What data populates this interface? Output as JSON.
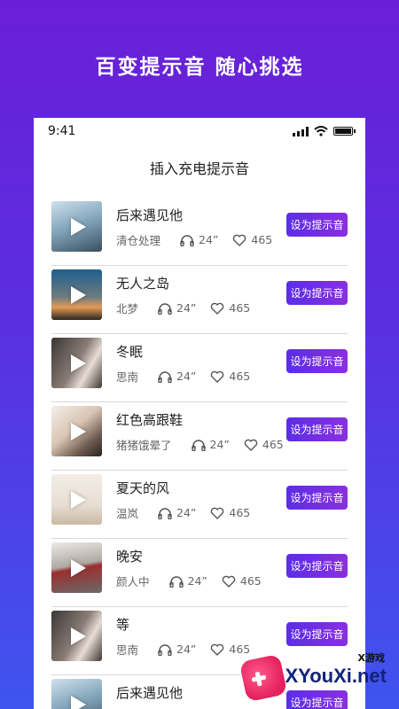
{
  "banner": {
    "title": "百变提示音 随心挑选"
  },
  "status_bar": {
    "time": "9:41"
  },
  "page": {
    "title": "插入充电提示音"
  },
  "button_label": "设为提示音",
  "songs": [
    {
      "title": "后来遇见他",
      "artist": "清仓处理",
      "duration": "24”",
      "likes": "465",
      "thumb": "t1"
    },
    {
      "title": "无人之岛",
      "artist": "北梦",
      "duration": "24”",
      "likes": "465",
      "thumb": "t2"
    },
    {
      "title": "冬眠",
      "artist": "思南",
      "duration": "24”",
      "likes": "465",
      "thumb": "t3"
    },
    {
      "title": "红色高跟鞋",
      "artist": "猪猪饿晕了",
      "duration": "24”",
      "likes": "465",
      "thumb": "t4"
    },
    {
      "title": "夏天的风",
      "artist": "温岚",
      "duration": "24”",
      "likes": "465",
      "thumb": "t5"
    },
    {
      "title": "晚安",
      "artist": "颜人中",
      "duration": "24”",
      "likes": "465",
      "thumb": "t6"
    },
    {
      "title": "等",
      "artist": "思南",
      "duration": "24”",
      "likes": "465",
      "thumb": "t7"
    },
    {
      "title": "后来遇见他",
      "artist": "",
      "duration": "",
      "likes": "",
      "thumb": "t8"
    }
  ],
  "icons": {
    "headphone": "headphone-icon",
    "heart": "heart-icon",
    "play": "play-icon"
  },
  "watermark": {
    "small": "X游戏",
    "big": "XYouXi.net"
  },
  "colors": {
    "accent": "#6a2fe4",
    "bg_top": "#6a1fd6",
    "bg_bottom": "#3f54ee"
  }
}
